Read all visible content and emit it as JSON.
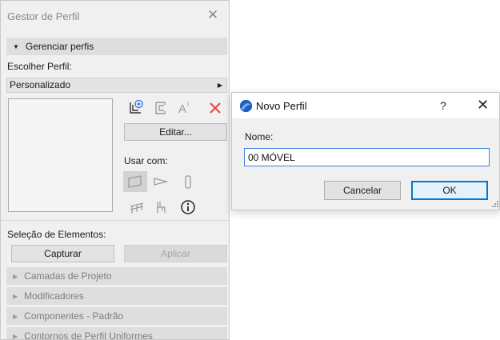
{
  "profile_manager": {
    "title": "Gestor de Perfil",
    "manage_section": "Gerenciar perfis",
    "choose_label": "Escolher Perfil:",
    "selected_profile": "Personalizado",
    "edit_button": "Editar...",
    "use_with_label": "Usar com:",
    "element_selection_label": "Seleção de Elementos:",
    "capture_button": "Capturar",
    "apply_button": "Aplicar",
    "sections": [
      "Camadas de Projeto",
      "Modificadores",
      "Componentes - Padrão",
      "Contornos de Perfil Uniformes"
    ],
    "toolbar_icons": [
      "new-profile-icon",
      "duplicate-profile-icon",
      "rename-icon",
      "delete-icon"
    ],
    "use_with_icons": [
      "wall-icon",
      "beam-icon",
      "column-icon",
      "railing-icon",
      "chair-icon",
      "info-icon"
    ]
  },
  "new_profile_dialog": {
    "title": "Novo Perfil",
    "help": "?",
    "name_label": "Nome:",
    "name_value": "00 MÓVEL",
    "cancel_button": "Cancelar",
    "ok_button": "OK"
  },
  "colors": {
    "accent_blue": "#0078d7",
    "delete_red": "#e8463c",
    "panel_bg": "#f0f0f0"
  }
}
